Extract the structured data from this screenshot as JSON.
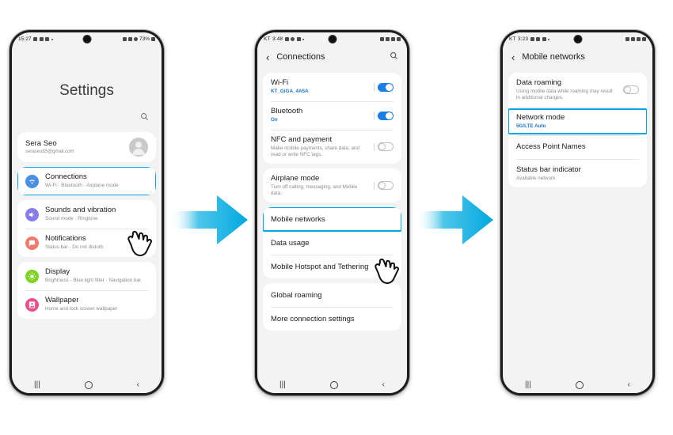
{
  "phones": [
    {
      "id": "settings-home",
      "statusbar": {
        "time": "15:27",
        "carrier": "",
        "battery": "73%",
        "left_icons": [
          "sound-icon",
          "image-icon",
          "mail-icon",
          "dot-icon"
        ],
        "right_icons": [
          "mute-icon",
          "wifi-icon",
          "dnd-icon",
          "battery-icon"
        ]
      },
      "page_title": "Settings",
      "search_icon": "search-icon",
      "profile": {
        "name": "Sera Seo",
        "email": "seraseo85@gmail.com",
        "avatar": "avatar-icon"
      },
      "items": [
        {
          "title": "Connections",
          "sub": "Wi-Fi  ·  Bluetooth  ·  Airplane mode",
          "icon": "wifi-icon",
          "color": "#4a90e2",
          "highlighted": true
        },
        {
          "title": "Sounds and vibration",
          "sub": "Sound mode  ·  Ringtone",
          "icon": "speaker-icon",
          "color": "#8a7ce8",
          "highlighted": false
        },
        {
          "title": "Notifications",
          "sub": "Status bar  ·  Do not disturb",
          "icon": "bell-icon",
          "color": "#f07a6e",
          "highlighted": false
        },
        {
          "title": "Display",
          "sub": "Brightness  ·  Blue light filter  ·  Navigation bar",
          "icon": "brightness-icon",
          "color": "#7ed321",
          "highlighted": false
        },
        {
          "title": "Wallpaper",
          "sub": "Home and lock screen wallpaper",
          "icon": "wallpaper-icon",
          "color": "#ec4d8e",
          "highlighted": false
        }
      ],
      "navbar": [
        "recents-icon",
        "home-icon",
        "back-icon"
      ]
    },
    {
      "id": "connections",
      "statusbar": {
        "time": "3:48",
        "carrier": "KT",
        "battery": "",
        "left_icons": [
          "battery-icon",
          "chat-icon",
          "video-icon",
          "dot-icon"
        ],
        "right_icons": [
          "alarm-icon",
          "signal-icon",
          "wifi-icon",
          "battery-icon"
        ]
      },
      "page_title": "Connections",
      "back_icon": "chevron-left-icon",
      "search_icon": "search-icon",
      "groups": [
        {
          "items": [
            {
              "title": "Wi-Fi",
              "sub": "KT_GiGA_4A5A",
              "sub_blue": true,
              "toggle": "on"
            },
            {
              "title": "Bluetooth",
              "sub": "On",
              "sub_blue": true,
              "toggle": "on"
            },
            {
              "title": "NFC and payment",
              "sub": "Make mobile payments, share data, and read or write NFC tags.",
              "sub_blue": false,
              "toggle": "off"
            }
          ]
        },
        {
          "items": [
            {
              "title": "Airplane mode",
              "sub": "Turn off calling, messaging, and Mobile data.",
              "sub_blue": false,
              "toggle": "off"
            }
          ]
        },
        {
          "items": [
            {
              "title": "Mobile networks",
              "sub": "",
              "sub_blue": false,
              "toggle": "",
              "highlighted": true
            },
            {
              "title": "Data usage",
              "sub": "",
              "sub_blue": false,
              "toggle": ""
            },
            {
              "title": "Mobile Hotspot and Tethering",
              "sub": "",
              "sub_blue": false,
              "toggle": ""
            }
          ]
        },
        {
          "items": [
            {
              "title": "Global roaming",
              "sub": "",
              "sub_blue": false,
              "toggle": ""
            },
            {
              "title": "More connection settings",
              "sub": "",
              "sub_blue": false,
              "toggle": ""
            }
          ]
        }
      ],
      "navbar": [
        "recents-icon",
        "home-icon",
        "back-icon"
      ]
    },
    {
      "id": "mobile-networks",
      "statusbar": {
        "time": "3:23",
        "carrier": "KT",
        "battery": "",
        "left_icons": [
          "image-icon",
          "battery-icon",
          "chat-icon",
          "dot-icon"
        ],
        "right_icons": [
          "alarm-icon",
          "signal-icon",
          "wifi-icon",
          "battery-icon"
        ]
      },
      "page_title": "Mobile networks",
      "back_icon": "chevron-left-icon",
      "groups": [
        {
          "items": [
            {
              "title": "Data roaming",
              "sub": "Using mobile data while roaming may result in additional charges.",
              "sub_blue": false,
              "toggle": "off"
            },
            {
              "title": "Network mode",
              "sub": "5G/LTE Auto",
              "sub_blue": true,
              "toggle": "",
              "highlighted": true
            },
            {
              "title": "Access Point Names",
              "sub": "",
              "sub_blue": false,
              "toggle": ""
            },
            {
              "title": "Status bar indicator",
              "sub": "Available network",
              "sub_blue": false,
              "toggle": ""
            }
          ]
        }
      ],
      "navbar": [
        "recents-icon",
        "home-icon",
        "back-icon"
      ]
    }
  ],
  "arrows": [
    {
      "name": "flow-arrow-1",
      "from": "settings-home",
      "to": "connections"
    },
    {
      "name": "flow-arrow-2",
      "from": "connections",
      "to": "mobile-networks"
    }
  ],
  "cursors": [
    {
      "name": "hand-cursor-connections",
      "target": "Connections"
    },
    {
      "name": "hand-cursor-mobile-networks",
      "target": "Mobile networks"
    }
  ],
  "colors": {
    "accent_highlight": "#00a8e8",
    "toggle_on": "#1a7ee8",
    "link_blue": "#1976d2",
    "screen_bg": "#f3f3f3",
    "card_bg": "#ffffff"
  }
}
